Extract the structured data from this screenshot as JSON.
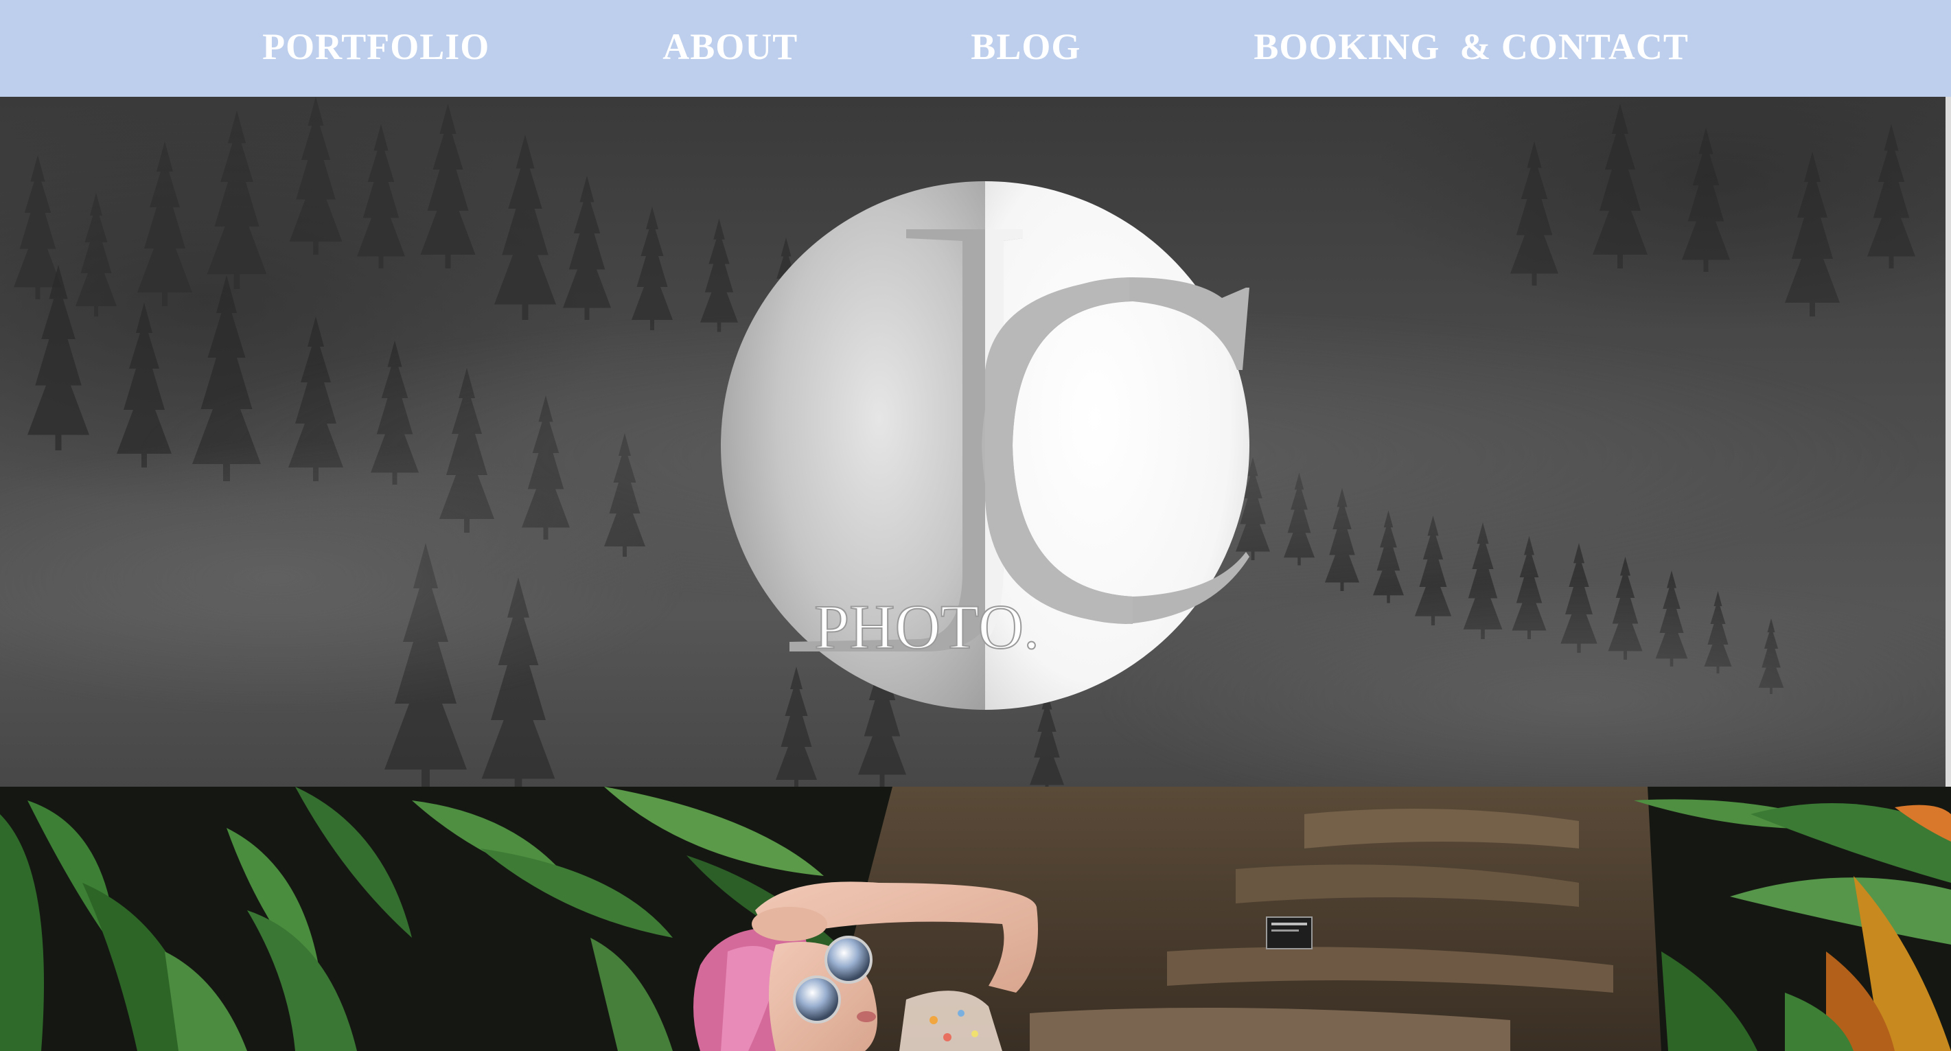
{
  "nav": {
    "items": [
      {
        "label": "PORTFOLIO"
      },
      {
        "label": "ABOUT"
      },
      {
        "label": "BLOG"
      },
      {
        "label": "BOOKING  & CONTACT"
      }
    ]
  },
  "logo": {
    "monogram": "JC",
    "wordmark": "PHOTO."
  },
  "colors": {
    "nav_background": "#bdcfec",
    "nav_text": "#ffffff",
    "hero_overlay": "#4a4a4a"
  },
  "images": {
    "hero": "misty-pine-forest",
    "feature": "woman-pink-hair-mirrored-sunglasses-in-tropical-plants"
  }
}
